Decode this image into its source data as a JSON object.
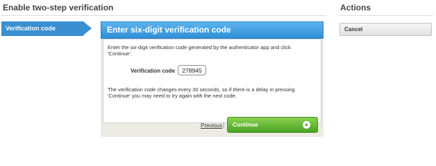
{
  "page": {
    "title": "Enable two-step verification"
  },
  "sidebar": {
    "steps": [
      {
        "label": "Verification code"
      }
    ]
  },
  "panel": {
    "header": "Enter six-digit verification code",
    "intro": "Enter the six-digit verification code generated by the authenticator app and click 'Continue'.",
    "code_label": "Verification code",
    "code_value": "278945",
    "note": "The verification code changes every 30 seconds, so if there is a delay in pressing 'Continue' you may need to try again with the next code."
  },
  "footer": {
    "previous_label": "Previous",
    "separator": "|",
    "continue_label": "Continue"
  },
  "actions": {
    "title": "Actions",
    "cancel_label": "Cancel"
  },
  "colors": {
    "accent_blue": "#3a8fd0",
    "continue_green": "#4aa221",
    "panel_bg": "#ecebe3"
  },
  "icons": {
    "continue": "play-circle-icon"
  }
}
